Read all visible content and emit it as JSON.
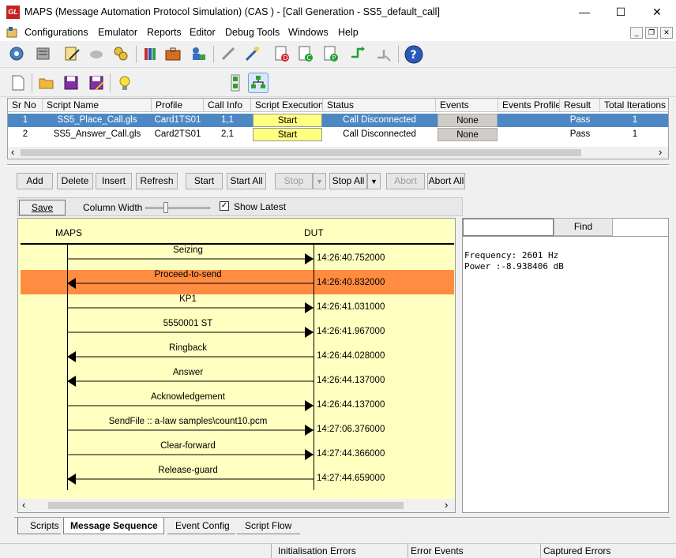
{
  "window": {
    "logo_text": "GL",
    "title": "MAPS (Message Automation Protocol Simulation)  (CAS  ) - [Call Generation  - SS5_default_call]",
    "minimize_glyph": "—",
    "maximize_glyph": "☐",
    "close_glyph": "✕"
  },
  "menu": {
    "items": [
      "Configurations",
      "Emulator",
      "Reports",
      "Editor",
      "Debug Tools",
      "Windows",
      "Help"
    ],
    "mdi_min": "_",
    "mdi_restore": "❐",
    "mdi_close": "✕"
  },
  "table": {
    "headers": [
      "Sr No",
      "Script Name",
      "Profile",
      "Call Info",
      "Script Execution",
      "Status",
      "Events",
      "Events Profile",
      "Result",
      "Total Iterations"
    ],
    "rows": [
      {
        "sr": "1",
        "script": "SS5_Place_Call.gls",
        "profile": "Card1TS01",
        "call_info": "1,1",
        "exec": "Start",
        "status": "Call Disconnected",
        "events": "None",
        "events_profile": "",
        "result": "Pass",
        "iterations": "1"
      },
      {
        "sr": "2",
        "script": "SS5_Answer_Call.gls",
        "profile": "Card2TS01",
        "call_info": "2,1",
        "exec": "Start",
        "status": "Call Disconnected",
        "events": "None",
        "events_profile": "",
        "result": "Pass",
        "iterations": "1"
      }
    ],
    "scroll_left": "‹",
    "scroll_right": "›"
  },
  "buttons": {
    "add": "Add",
    "delete": "Delete",
    "insert": "Insert",
    "refresh": "Refresh",
    "start": "Start",
    "start_all": "Start All",
    "stop": "Stop",
    "stop_all": "Stop All",
    "abort": "Abort",
    "abort_all": "Abort All"
  },
  "sequence": {
    "save": "Save",
    "column_width": "Column Width",
    "show_latest": "Show Latest",
    "left_entity": "MAPS",
    "right_entity": "DUT",
    "messages": [
      {
        "label": "Seizing",
        "dir": "right",
        "time": "14:26:40.752000",
        "highlight": false
      },
      {
        "label": "Proceed-to-send",
        "dir": "left",
        "time": "14:26:40.832000",
        "highlight": true
      },
      {
        "label": "KP1",
        "dir": "right",
        "time": "14:26:41.031000",
        "highlight": false
      },
      {
        "label": "5550001 ST",
        "dir": "right",
        "time": "14:26:41.967000",
        "highlight": false
      },
      {
        "label": "Ringback",
        "dir": "left",
        "time": "14:26:44.028000",
        "highlight": false
      },
      {
        "label": "Answer",
        "dir": "left",
        "time": "14:26:44.137000",
        "highlight": false
      },
      {
        "label": "Acknowledgement",
        "dir": "right",
        "time": "14:26:44.137000",
        "highlight": false
      },
      {
        "label": "SendFile :: a-law samples\\count10.pcm",
        "dir": "right",
        "time": "14:27:06.376000",
        "highlight": false
      },
      {
        "label": "Clear-forward",
        "dir": "right",
        "time": "14:27:44.366000",
        "highlight": false
      },
      {
        "label": "Release-guard",
        "dir": "left",
        "time": "14:27:44.659000",
        "highlight": false
      }
    ],
    "highlight_color": "#ff8c40",
    "background_color": "#ffffc0"
  },
  "details": {
    "find": "Find",
    "search_value": "",
    "lines": [
      "Frequency: 2601 Hz",
      "Power :-8.938406 dB"
    ]
  },
  "tabs": [
    "Scripts",
    "Message Sequence",
    "Event Config",
    "Script Flow"
  ],
  "active_tab": "Message Sequence",
  "status": {
    "init_errors": "Initialisation Errors",
    "error_events": "Error Events",
    "captured_errors": "Captured Errors"
  }
}
